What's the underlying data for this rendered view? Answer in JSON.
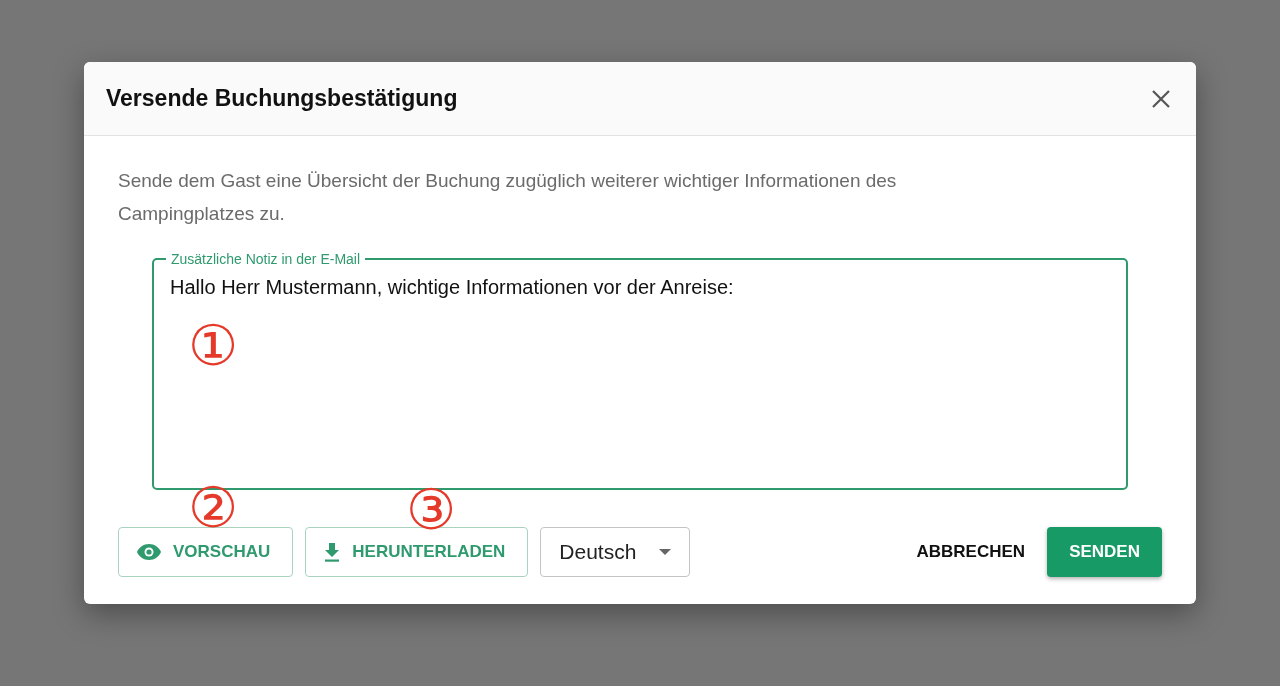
{
  "dialog": {
    "title": "Versende Buchungsbestätigung",
    "description": "Sende dem Gast eine Übersicht der Buchung zugüglich weiterer wichtiger Informationen des Campingplatzes zu.",
    "note_field": {
      "label": "Zusätzliche Notiz in der E-Mail",
      "value": "Hallo Herr Mustermann, wichtige Informationen vor der Anreise:"
    },
    "preview_button": "VORSCHAU",
    "download_button": "HERUNTERLADEN",
    "language_select": {
      "value": "Deutsch"
    },
    "cancel_button": "ABBRECHEN",
    "send_button": "SENDEN"
  },
  "annotations": [
    {
      "label": "①"
    },
    {
      "label": "②"
    },
    {
      "label": "③"
    }
  ]
}
